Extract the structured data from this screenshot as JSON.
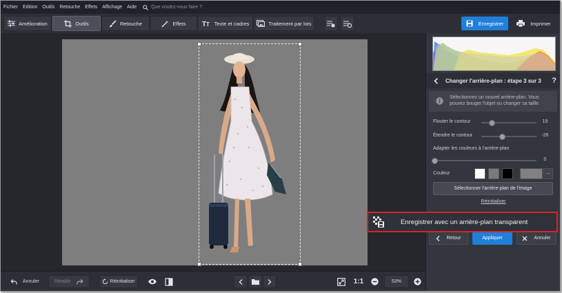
{
  "menu": {
    "items": [
      "Fichier",
      "Edition",
      "Outils",
      "Retouche",
      "Effets",
      "Affichage",
      "Aide"
    ],
    "search_placeholder": "Que voulez-vous faire ?"
  },
  "toolbar": {
    "tabs": [
      "Amélioration",
      "Outils",
      "Retouche",
      "Effets",
      "Texte et cadres",
      "Traitement par lots"
    ],
    "active_tab": "Outils",
    "save_label": "Enregistrer",
    "print_label": "Imprimer",
    "accent_color": "#1f7fd9"
  },
  "panel": {
    "step_title": "Changer l'arrière-plan : étape 3 sur 3",
    "help_symbol": "?",
    "info_text": "Sélectionnez un nouvel arrière-plan. Vous pouvez bouger l'objet ou changer sa taille.",
    "sliders": [
      {
        "label": "Flouter le contour",
        "value": "19",
        "fraction": 0.19
      },
      {
        "label": "Étendre le contour",
        "value": "-26",
        "fraction": 0.37
      },
      {
        "label": "Adapter les couleurs à l'arrière-plan",
        "value": "0",
        "fraction": 0.0
      }
    ],
    "color_label": "Couleur",
    "swatches": [
      "#ffffff",
      "#7a7a7a",
      "#000000"
    ],
    "current_color": "#808080",
    "more_symbol": "...",
    "select_bg_label": "Sélectionner l'arrière-plan de l'image",
    "reset_label": "Réinitialiser",
    "back_label": "Retour",
    "apply_label": "Appliquer",
    "cancel_label": "Annuler"
  },
  "callout": {
    "label": "Enregistrer avec un arrière-plan transparent",
    "border_color": "#d9232a"
  },
  "bottombar": {
    "undo_label": "Annuler",
    "redo_label": "Rétablir",
    "reset_label": "Réinitialiser",
    "zoom_one_label": "1:1",
    "zoom_value": "53%"
  }
}
